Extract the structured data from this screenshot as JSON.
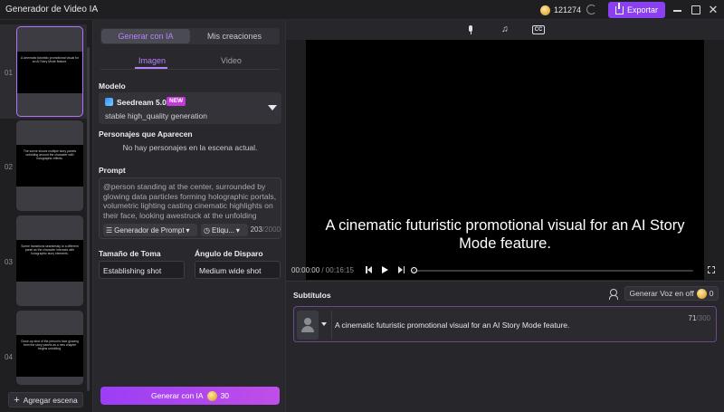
{
  "app": {
    "title": "Generador de Video IA",
    "coins": "121274",
    "export_label": "Exportar"
  },
  "scenes": [
    {
      "num": "01",
      "text": "A cinematic futuristic promotional visual for an AI Story Mode feature."
    },
    {
      "num": "02",
      "text": "The scene shows multiple story panels unfolding around the character with holographic effects."
    },
    {
      "num": "03",
      "text": "Scene transitions seamlessly to a different panel as the character interacts with holographic story elements."
    },
    {
      "num": "04",
      "text": "Close-up shot of the person's face glowing from the story panels as a new chapter begins unfolding."
    }
  ],
  "add_scene_label": "Agregar escena",
  "panel": {
    "tab_generate": "Generar con IA",
    "tab_creations": "Mis creaciones",
    "subtab_image": "Imagen",
    "subtab_video": "Video",
    "model_label": "Modelo",
    "model_name": "Seedream 5.0",
    "model_badge": "NEW",
    "model_desc": "stable high_quality generation",
    "characters_label": "Personajes que Aparecen",
    "characters_empty": "No hay personajes en la escena actual.",
    "prompt_label": "Prompt",
    "prompt_text": "@person standing at the center, surrounded by glowing data particles forming holographic portals, volumetric lighting casting cinematic highlights on their face, looking awestruck at the unfolding worlds",
    "prompt_gen_label": "Generador de Prompt",
    "prompt_tag_label": "Etiqu...",
    "prompt_count": "203",
    "prompt_max": "/2000",
    "shot_size_label": "Tamaño de Toma",
    "shot_size_value": "Establishing shot",
    "angle_label": "Ángulo de Disparo",
    "angle_value": "Medium wide shot",
    "generate_label": "Generar con IA",
    "generate_cost": "30"
  },
  "player": {
    "caption": "A cinematic futuristic promotional visual for an AI Story Mode feature.",
    "time_current": "00:00:00",
    "time_total": " / 00:16:15",
    "progress": 0
  },
  "subtitles": {
    "title": "Subtítulos",
    "voice_label": "Generar Voz en off",
    "voice_cost": "0",
    "row_text": "A cinematic futuristic promotional visual for an AI Story Mode feature.",
    "row_count": "71",
    "row_max": "/300"
  },
  "colors": {
    "accent": "#b683ff",
    "export": "#8a3ff0",
    "badge": "#c23bd8"
  }
}
